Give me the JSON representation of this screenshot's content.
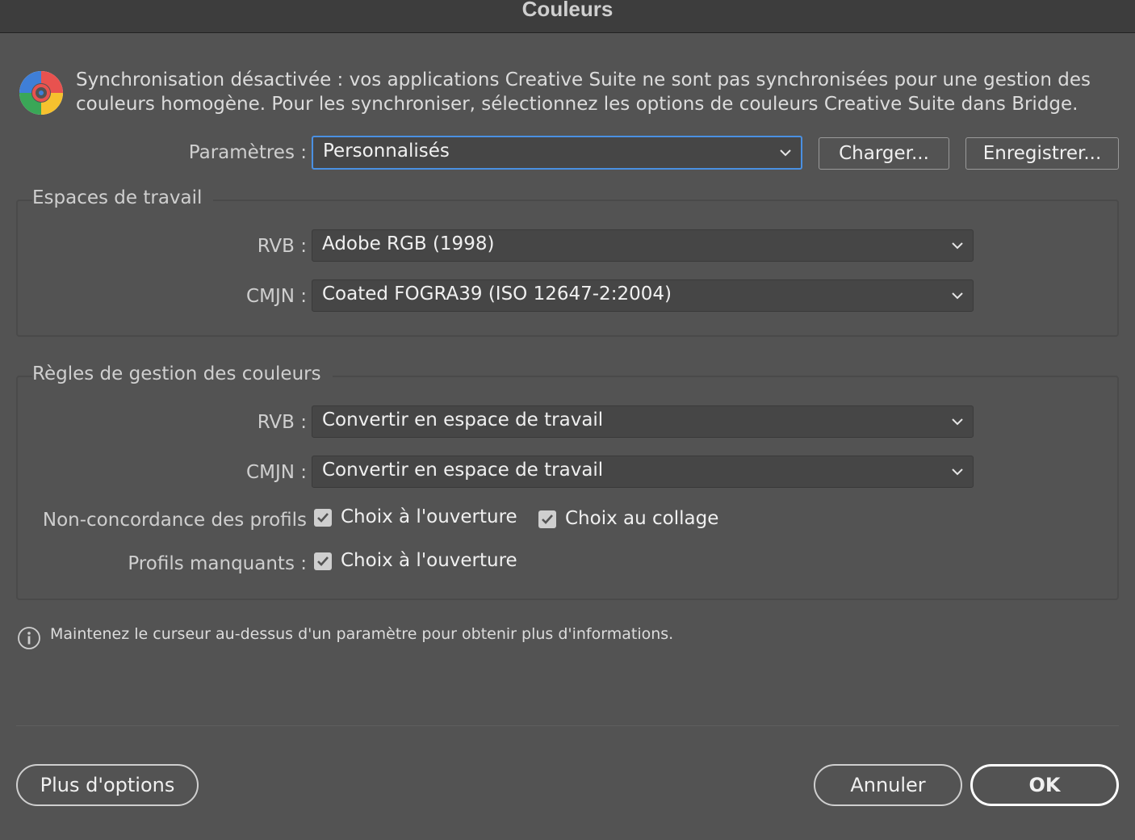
{
  "window": {
    "title": "Couleurs"
  },
  "sync": {
    "line1": "Synchronisation désactivée : vos applications Creative Suite ne sont pas synchronisées pour une gestion des",
    "line2": "couleurs homogène. Pour les synchroniser, sélectionnez les options de couleurs Creative Suite dans Bridge."
  },
  "settings": {
    "label": "Paramètres :",
    "value": "Personnalisés",
    "load_label": "Charger...",
    "save_label": "Enregistrer..."
  },
  "working_spaces": {
    "title": "Espaces de travail",
    "rgb_label": "RVB :",
    "rgb_value": "Adobe RGB (1998)",
    "cmyk_label": "CMJN :",
    "cmyk_value": "Coated FOGRA39 (ISO 12647-2:2004)"
  },
  "policies": {
    "title": "Règles de gestion des couleurs",
    "rgb_label": "RVB :",
    "rgb_value": "Convertir en espace de travail",
    "cmyk_label": "CMJN :",
    "cmyk_value": "Convertir en espace de travail",
    "mismatch_label": "Non-concordance des profils",
    "mismatch_open_label": "Choix à l'ouverture",
    "mismatch_open_checked": true,
    "mismatch_paste_label": "Choix au collage",
    "mismatch_paste_checked": true,
    "missing_label": "Profils manquants :",
    "missing_open_label": "Choix à l'ouverture",
    "missing_open_checked": true
  },
  "info": {
    "text": "Maintenez le curseur au-dessus d'un paramètre pour obtenir plus d'informations."
  },
  "footer": {
    "more_options_label": "Plus d'options",
    "cancel_label": "Annuler",
    "ok_label": "OK"
  },
  "colors": {
    "background": "#535353",
    "focus_ring": "#4a90e2"
  },
  "icons": {
    "sync": "color-wheel-icon",
    "dropdown": "chevron-down-icon",
    "check": "checkmark-icon",
    "info": "info-icon"
  }
}
